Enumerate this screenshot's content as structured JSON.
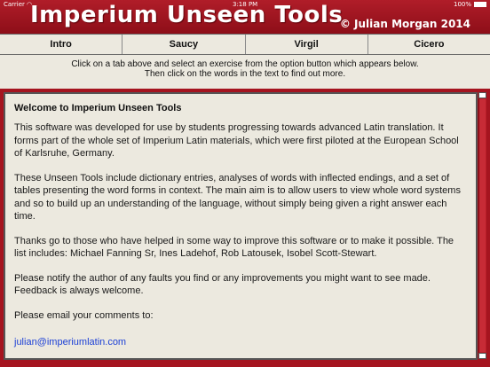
{
  "status_bar": {
    "carrier": "Carrier",
    "time": "3:18 PM",
    "battery": "100%"
  },
  "header": {
    "title": "Imperium Unseen Tools",
    "copyright": "© Julian Morgan 2014"
  },
  "tabs": [
    {
      "label": "Intro"
    },
    {
      "label": "Saucy"
    },
    {
      "label": "Virgil"
    },
    {
      "label": "Cicero"
    }
  ],
  "instructions": {
    "line1": "Click on a tab above and select an exercise from the option button which appears below.",
    "line2": "Then click on the words in the text to find out more."
  },
  "content": {
    "heading": "Welcome to Imperium Unseen Tools",
    "p1": "This software was developed for use by students progressing towards advanced Latin translation. It forms part of the whole set of Imperium Latin materials, which were first piloted at the European School of Karlsruhe, Germany.",
    "p2": "These Unseen Tools include dictionary entries, analyses of words with inflected endings, and a set of tables presenting the word forms in context. The main aim is to allow users to view whole word systems and so to build up an understanding of the language, without simply being given a right answer each time.",
    "p3": "Thanks go to those who have helped in some way to improve this software or to make it possible. The list includes: Michael Fanning Sr, Ines Ladehof, Rob Latousek, Isobel Scott-Stewart.",
    "p4": "Please notify the author of any faults you find or any improvements you might want to see made. Feedback is always welcome.",
    "p5": "Please email your comments to:",
    "email": "julian@imperiumlatin.com"
  }
}
